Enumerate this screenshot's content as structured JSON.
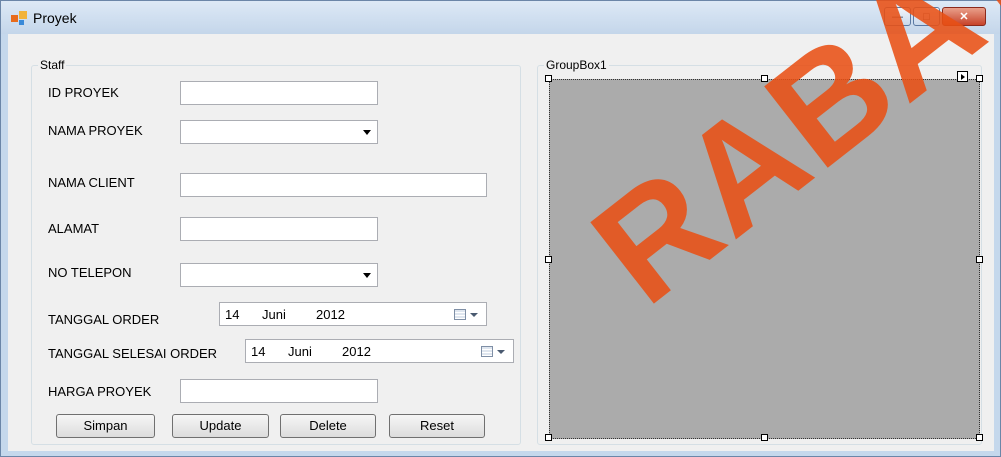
{
  "window": {
    "title": "Proyek",
    "caption_buttons": [
      "minimize-icon",
      "maximize-icon",
      "close-icon"
    ]
  },
  "staff_group": {
    "title": "Staff",
    "fields": {
      "id_proyek": {
        "label": "ID PROYEK",
        "value": ""
      },
      "nama_proyek": {
        "label": "NAMA PROYEK",
        "value": ""
      },
      "nama_client": {
        "label": "NAMA CLIENT",
        "value": ""
      },
      "alamat": {
        "label": "ALAMAT",
        "value": ""
      },
      "no_telepon": {
        "label": "NO TELEPON",
        "value": ""
      },
      "tanggal_order": {
        "label": "TANGGAL ORDER",
        "day": "14",
        "month": "Juni",
        "year": "2012"
      },
      "tanggal_selesai": {
        "label": "TANGGAL SELESAI ORDER",
        "day": "14",
        "month": "Juni",
        "year": "2012"
      },
      "harga_proyek": {
        "label": "HARGA PROYEK",
        "value": ""
      }
    },
    "buttons": {
      "simpan": "Simpan",
      "update": "Update",
      "delete": "Delete",
      "reset": "Reset"
    }
  },
  "groupbox1": {
    "title": "GroupBox1"
  },
  "watermark": {
    "text": "RABAYA",
    "color": "#e85014"
  }
}
